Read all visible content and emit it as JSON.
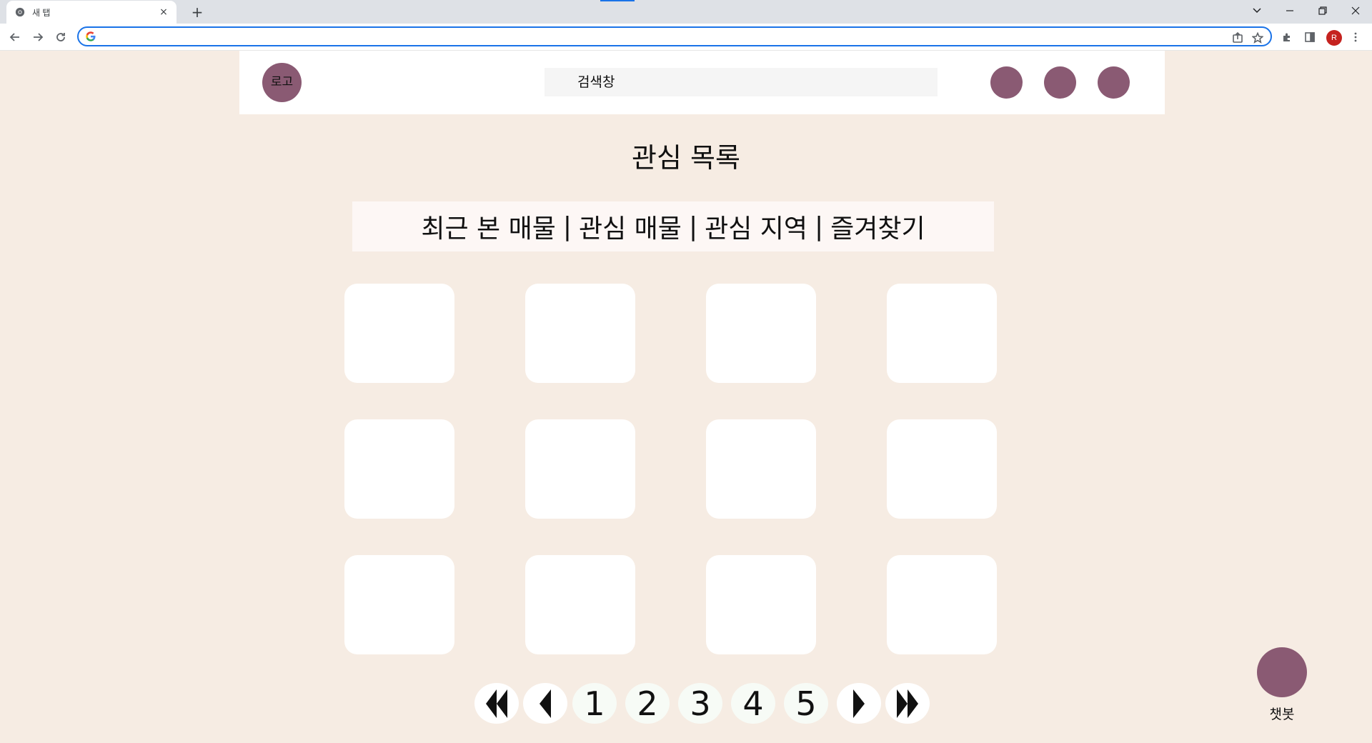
{
  "browser": {
    "tab_title": "새 탭",
    "tab_close": "×",
    "new_tab": "+",
    "address_value": "",
    "profile_initial": "R"
  },
  "header": {
    "logo_label": "로고",
    "search_text": "검색창"
  },
  "page": {
    "title": "관심 목록",
    "tabs": [
      {
        "label": "최근 본 매물"
      },
      {
        "label": "관심 매물"
      },
      {
        "label": "관심 지역"
      },
      {
        "label": "즐겨찾기"
      }
    ],
    "separator": "|"
  },
  "pagination": {
    "pages": [
      "1",
      "2",
      "3",
      "4",
      "5"
    ]
  },
  "chatbot": {
    "label": "챗봇"
  },
  "colors": {
    "page_bg": "#f6ece3",
    "accent": "#8a5a73"
  }
}
